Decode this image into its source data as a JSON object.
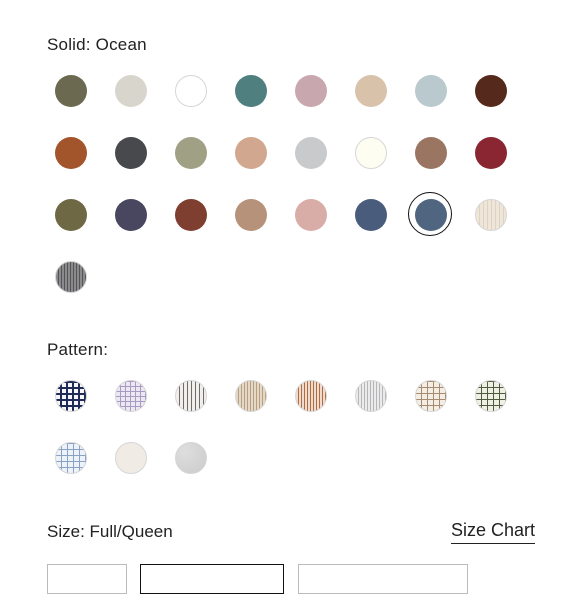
{
  "solid": {
    "label_prefix": "Solid:",
    "selected_name": "Ocean",
    "swatches": [
      {
        "name": "olive",
        "color": "#6b6a50"
      },
      {
        "name": "stone",
        "color": "#d8d6cc"
      },
      {
        "name": "white",
        "color": "#ffffff",
        "light": true
      },
      {
        "name": "teal",
        "color": "#4f7f7e"
      },
      {
        "name": "rose",
        "color": "#c8a8ae"
      },
      {
        "name": "sand",
        "color": "#d8c2aa"
      },
      {
        "name": "mist",
        "color": "#b9c9ce"
      },
      {
        "name": "chocolate",
        "color": "#552a1c"
      },
      {
        "name": "rust",
        "color": "#a2542a"
      },
      {
        "name": "charcoal",
        "color": "#48494d"
      },
      {
        "name": "sage",
        "color": "#a0a084"
      },
      {
        "name": "clay",
        "color": "#d1a88f"
      },
      {
        "name": "silver",
        "color": "#c9cacc"
      },
      {
        "name": "ivory",
        "color": "#fdfdf1",
        "light": true
      },
      {
        "name": "mocha",
        "color": "#9a7562"
      },
      {
        "name": "wine",
        "color": "#8a2632"
      },
      {
        "name": "moss",
        "color": "#6e6845"
      },
      {
        "name": "navy",
        "color": "#48475f"
      },
      {
        "name": "brick",
        "color": "#7e3f31"
      },
      {
        "name": "tan",
        "color": "#b7927b"
      },
      {
        "name": "blush",
        "color": "#d8ada7"
      },
      {
        "name": "denim",
        "color": "#495c7b"
      },
      {
        "name": "Ocean",
        "color": "#4f6580",
        "selected": true
      },
      {
        "name": "cream-stripe",
        "color": "#ede4d8",
        "pattern": "stripes-light"
      },
      {
        "name": "grey-stripe",
        "color": "#7b7b7e",
        "pattern": "stripes-dark"
      }
    ]
  },
  "pattern": {
    "label": "Pattern:",
    "swatches": [
      {
        "name": "navy-plaid",
        "pattern": "plaid-navy"
      },
      {
        "name": "lavender-plaid",
        "pattern": "plaid-lavender"
      },
      {
        "name": "grey-pinstripe",
        "pattern": "pinstripe-grey"
      },
      {
        "name": "sand-stripe",
        "pattern": "stripe-sand"
      },
      {
        "name": "rust-stripe",
        "pattern": "stripe-rust"
      },
      {
        "name": "silver-stripe",
        "pattern": "stripe-silver"
      },
      {
        "name": "tan-grid",
        "pattern": "grid-tan"
      },
      {
        "name": "olive-grid",
        "pattern": "grid-olive"
      },
      {
        "name": "blue-grid",
        "pattern": "grid-blue"
      },
      {
        "name": "linen",
        "pattern": "solid-linen"
      },
      {
        "name": "heather",
        "pattern": "heather-grey"
      }
    ]
  },
  "size": {
    "label_prefix": "Size:",
    "selected": "Full/Queen",
    "chart_link": "Size Chart"
  }
}
